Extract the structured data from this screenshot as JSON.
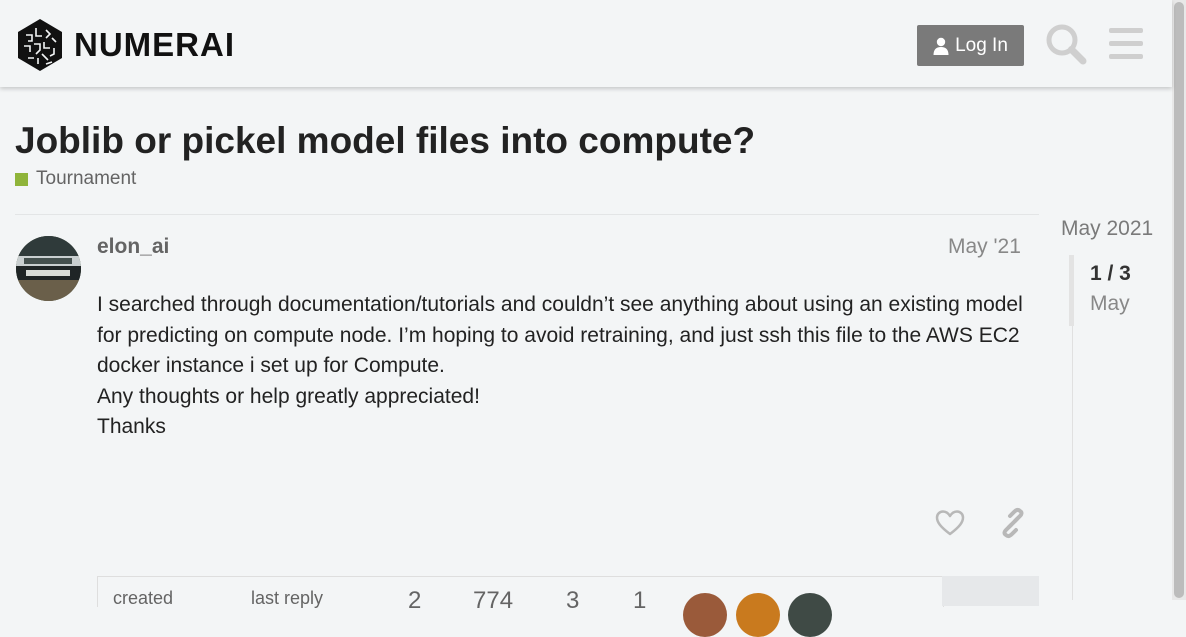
{
  "header": {
    "brand": "NUMERAI",
    "login_label": "Log In",
    "icons": [
      "user-icon",
      "search-icon",
      "hamburger-menu-icon"
    ]
  },
  "topic": {
    "title": "Joblib or pickel model files into compute?",
    "category": "Tournament",
    "category_color": "#8fb43a"
  },
  "post": {
    "username": "elon_ai",
    "date": "May '21",
    "paragraphs": [
      "I searched through documentation/tutorials and couldn’t see anything about using an existing model for predicting on compute node. I’m hoping to avoid retraining, and just ssh this file to the AWS EC2 docker instance i set up for Compute.",
      "Any thoughts or help greatly appreciated!",
      "Thanks"
    ],
    "action_icons": [
      "heart-icon",
      "link-icon"
    ]
  },
  "timeline": {
    "start_date": "May 2021",
    "position": "1 / 3",
    "current_month": "May"
  },
  "summary": {
    "created_label": "created",
    "last_reply_label": "last reply",
    "replies": "2",
    "views": "774",
    "users": "3",
    "likes": "1"
  },
  "colors": {
    "background": "#f3f5f6",
    "button": "#7a7a7a",
    "icon": "#cfcfcf"
  }
}
